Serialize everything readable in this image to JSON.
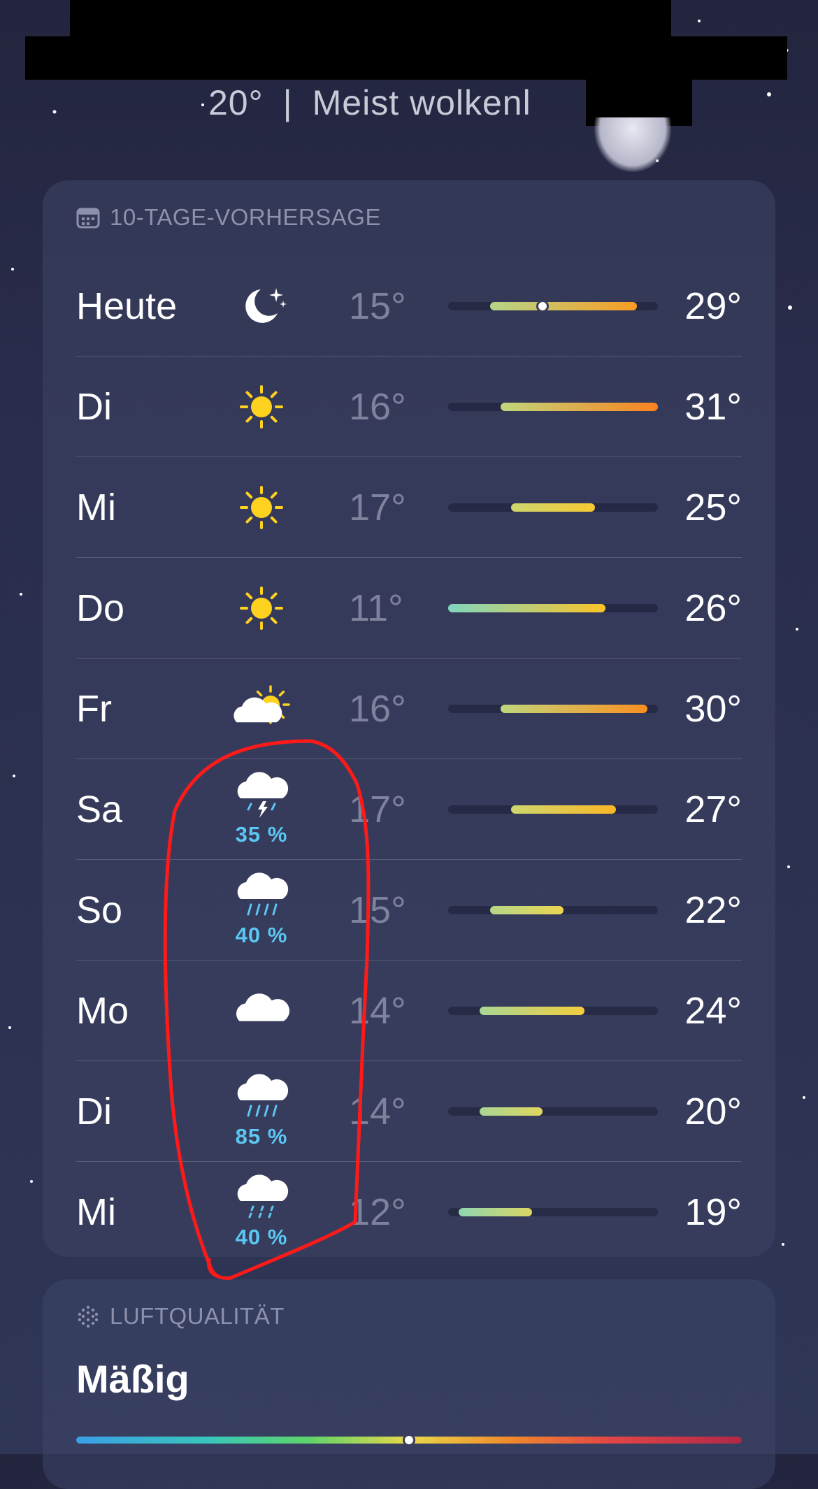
{
  "current": {
    "temp": "20°",
    "separator": "|",
    "condition": "Meist wolkenl"
  },
  "forecast": {
    "header": "10-TAGE-VORHERSAGE",
    "header_icon": "calendar-icon",
    "range_min": 11,
    "range_max": 31,
    "days": [
      {
        "day": "Heute",
        "icon": "moon-stars-icon",
        "precip": "",
        "lo": "15°",
        "hi": "29°",
        "lo_val": 15,
        "hi_val": 29,
        "current_val": 20
      },
      {
        "day": "Di",
        "icon": "sun-icon",
        "precip": "",
        "lo": "16°",
        "hi": "31°",
        "lo_val": 16,
        "hi_val": 31
      },
      {
        "day": "Mi",
        "icon": "sun-icon",
        "precip": "",
        "lo": "17°",
        "hi": "25°",
        "lo_val": 17,
        "hi_val": 25
      },
      {
        "day": "Do",
        "icon": "sun-icon",
        "precip": "",
        "lo": "11°",
        "hi": "26°",
        "lo_val": 11,
        "hi_val": 26
      },
      {
        "day": "Fr",
        "icon": "sun-behind-cloud-icon",
        "precip": "",
        "lo": "16°",
        "hi": "30°",
        "lo_val": 16,
        "hi_val": 30
      },
      {
        "day": "Sa",
        "icon": "thunderstorm-icon",
        "precip": "35 %",
        "lo": "17°",
        "hi": "27°",
        "lo_val": 17,
        "hi_val": 27
      },
      {
        "day": "So",
        "icon": "rain-cloud-icon",
        "precip": "40 %",
        "lo": "15°",
        "hi": "22°",
        "lo_val": 15,
        "hi_val": 22
      },
      {
        "day": "Mo",
        "icon": "cloud-icon",
        "precip": "",
        "lo": "14°",
        "hi": "24°",
        "lo_val": 14,
        "hi_val": 24
      },
      {
        "day": "Di",
        "icon": "rain-cloud-icon",
        "precip": "85 %",
        "lo": "14°",
        "hi": "20°",
        "lo_val": 14,
        "hi_val": 20
      },
      {
        "day": "Mi",
        "icon": "drizzle-cloud-icon",
        "precip": "40 %",
        "lo": "12°",
        "hi": "19°",
        "lo_val": 12,
        "hi_val": 19
      }
    ]
  },
  "air_quality": {
    "header": "LUFTQUALITÄT",
    "header_icon": "air-quality-icon",
    "value": "Mäßig",
    "level_fraction": 0.5
  },
  "colors": {
    "precip": "#5bc7f3",
    "annotation": "#ff1a1a",
    "sun": "#ffd21f"
  }
}
